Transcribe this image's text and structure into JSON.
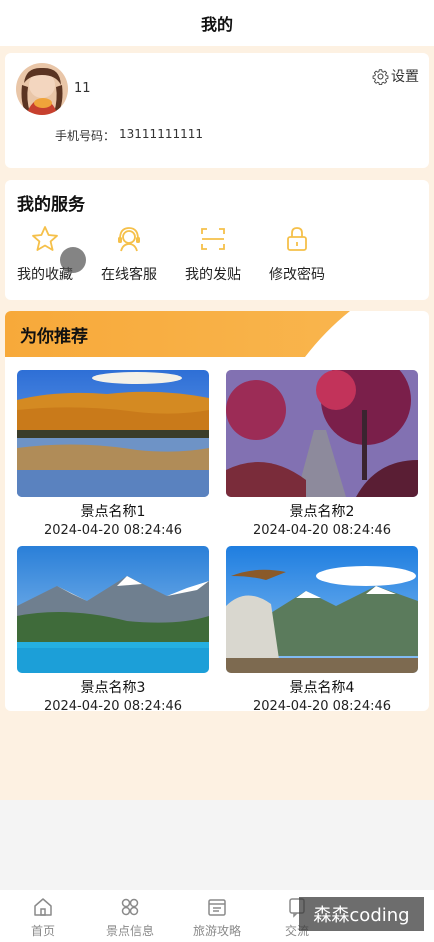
{
  "header": {
    "title": "我的"
  },
  "profile": {
    "username": "11",
    "settings_label": "设置",
    "phone_label": "手机号码：",
    "phone_value": "13111111111"
  },
  "services": {
    "title": "我的服务",
    "items": [
      {
        "label": "我的收藏",
        "icon": "star-icon"
      },
      {
        "label": "在线客服",
        "icon": "customer-service-icon"
      },
      {
        "label": "我的发贴",
        "icon": "scan-post-icon"
      },
      {
        "label": "修改密码",
        "icon": "lock-icon"
      }
    ],
    "icon_color": "#f5c04a"
  },
  "recommend": {
    "title": "为你推荐",
    "accent": "#f7a93a",
    "spots": [
      {
        "name": "景点名称1",
        "date": "2024-04-20 08:24:46"
      },
      {
        "name": "景点名称2",
        "date": "2024-04-20 08:24:46"
      },
      {
        "name": "景点名称3",
        "date": "2024-04-20 08:24:46"
      },
      {
        "name": "景点名称4",
        "date": "2024-04-20 08:24:46"
      }
    ]
  },
  "tabbar": {
    "tabs": [
      {
        "label": "首页",
        "icon": "home-icon"
      },
      {
        "label": "景点信息",
        "icon": "grid-icon"
      },
      {
        "label": "旅游攻略",
        "icon": "calendar-icon"
      },
      {
        "label": "交流",
        "icon": "chat-icon"
      }
    ]
  },
  "watermark": "森森coding"
}
